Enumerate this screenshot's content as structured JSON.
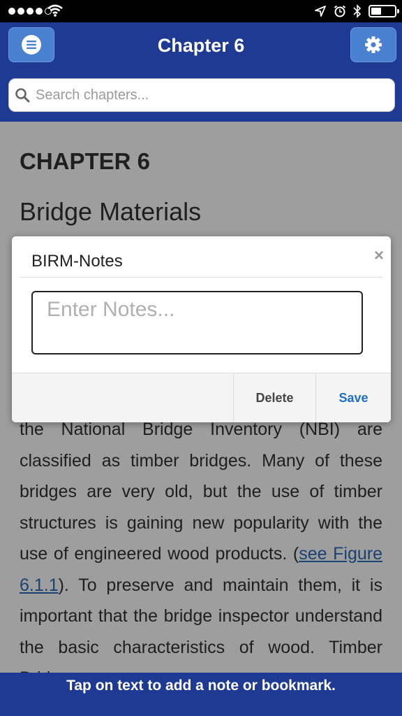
{
  "status_bar": {
    "signal_dots": 5,
    "signal_filled": 4,
    "icons": [
      "signal-icon",
      "wifi-icon",
      "location-icon",
      "alarm-icon",
      "bluetooth-icon",
      "battery-icon"
    ]
  },
  "header": {
    "title": "Chapter 6",
    "menu_icon": "hamburger-menu-icon",
    "settings_icon": "gear-icon"
  },
  "search": {
    "placeholder": "Search chapters..."
  },
  "content": {
    "chapter_label": "CHAPTER 6",
    "chapter_title": "Bridge Materials",
    "text_1": "the National Bridge Inventory (NBI) are classified as timber bridges. Many of these bridges are very old, but the use of timber structures is gaining new popularity with the use of engineered wood products. (",
    "link_see": "see",
    "link_figure": "Figure 6.1.1",
    "text_2": "). To preserve and maintain them, it is important that the bridge inspector understand the basic characteristics of wood. Timber Bridges"
  },
  "modal": {
    "title": "BIRM-Notes",
    "close_symbol": "×",
    "notes_placeholder": "Enter Notes...",
    "notes_value": "",
    "delete_label": "Delete",
    "save_label": "Save"
  },
  "bottom_bar": {
    "text": "Tap on text to add a note or bookmark."
  },
  "colors": {
    "header_bg": "#1f3a93",
    "button_bg": "#4a80d0",
    "save_color": "#1f6fc8",
    "link_color": "#2a6bb8"
  }
}
